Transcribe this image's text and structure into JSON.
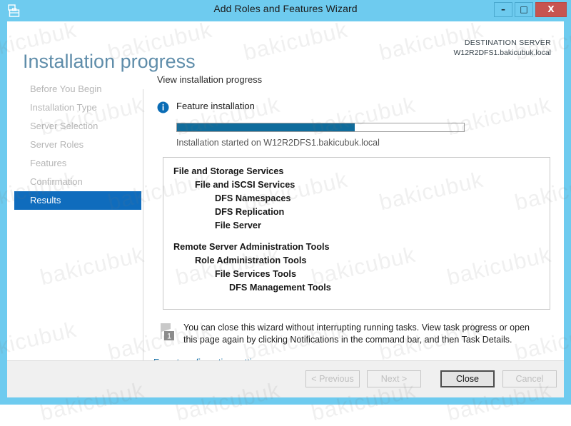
{
  "window": {
    "title": "Add Roles and Features Wizard",
    "icon": "wizard-briefcase-icon",
    "minimize_label": "–",
    "maximize_label": "□",
    "close_label": "X",
    "frame_color": "#6ecbef",
    "close_button_color": "#c75450"
  },
  "header": {
    "page_title": "Installation progress",
    "destination_label": "DESTINATION SERVER",
    "destination_server": "W12R2DFS1.bakicubuk.local",
    "title_color": "#5f8daa"
  },
  "sidebar": {
    "accent_color": "#0f6cbd",
    "items": [
      {
        "label": "Before You Begin",
        "active": false
      },
      {
        "label": "Installation Type",
        "active": false
      },
      {
        "label": "Server Selection",
        "active": false
      },
      {
        "label": "Server Roles",
        "active": false
      },
      {
        "label": "Features",
        "active": false
      },
      {
        "label": "Confirmation",
        "active": false
      },
      {
        "label": "Results",
        "active": true
      }
    ]
  },
  "main": {
    "subheading": "View installation progress",
    "feature_status": {
      "icon": "info-icon",
      "label": "Feature installation",
      "progress_percent": 62,
      "progress_fill_color": "#0f6c9c",
      "caption": "Installation started on W12R2DFS1.bakicubuk.local"
    },
    "installed_tree": [
      {
        "label": "File and Storage Services",
        "level": 0
      },
      {
        "label": "File and iSCSI Services",
        "level": 1
      },
      {
        "label": "DFS Namespaces",
        "level": 2
      },
      {
        "label": "DFS Replication",
        "level": 2
      },
      {
        "label": "File Server",
        "level": 2
      },
      {
        "label": "Remote Server Administration Tools",
        "level": 0
      },
      {
        "label": "Role Administration Tools",
        "level": 1
      },
      {
        "label": "File Services Tools",
        "level": 2
      },
      {
        "label": "DFS Management Tools",
        "level": 3
      }
    ],
    "notice": {
      "icon": "notification-flag-icon",
      "badge": "1",
      "text": "You can close this wizard without interrupting running tasks. View task progress or open this page again by clicking Notifications in the command bar, and then Task Details."
    },
    "export_link": "Export configuration settings"
  },
  "footer": {
    "buttons": [
      {
        "label": "< Previous",
        "enabled": false,
        "default": false
      },
      {
        "label": "Next >",
        "enabled": false,
        "default": false
      },
      {
        "label": "Close",
        "enabled": true,
        "default": true
      },
      {
        "label": "Cancel",
        "enabled": false,
        "default": false
      }
    ]
  },
  "watermark": {
    "text": "bakicubuk"
  }
}
